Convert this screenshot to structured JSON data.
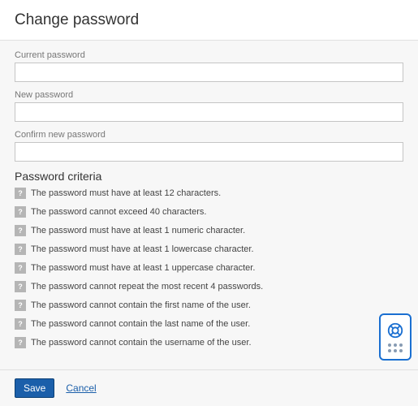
{
  "header": {
    "title": "Change password"
  },
  "fields": {
    "current": {
      "label": "Current password",
      "value": ""
    },
    "new": {
      "label": "New password",
      "value": ""
    },
    "confirm": {
      "label": "Confirm new password",
      "value": ""
    }
  },
  "criteria": {
    "title": "Password criteria",
    "items": [
      "The password must have at least 12 characters.",
      "The password cannot exceed 40 characters.",
      "The password must have at least 1 numeric character.",
      "The password must have at least 1 lowercase character.",
      "The password must have at least 1 uppercase character.",
      "The password cannot repeat the most recent 4 passwords.",
      "The password cannot contain the first name of the user.",
      "The password cannot contain the last name of the user.",
      "The password cannot contain the username of the user."
    ]
  },
  "footer": {
    "save_label": "Save",
    "cancel_label": "Cancel"
  }
}
